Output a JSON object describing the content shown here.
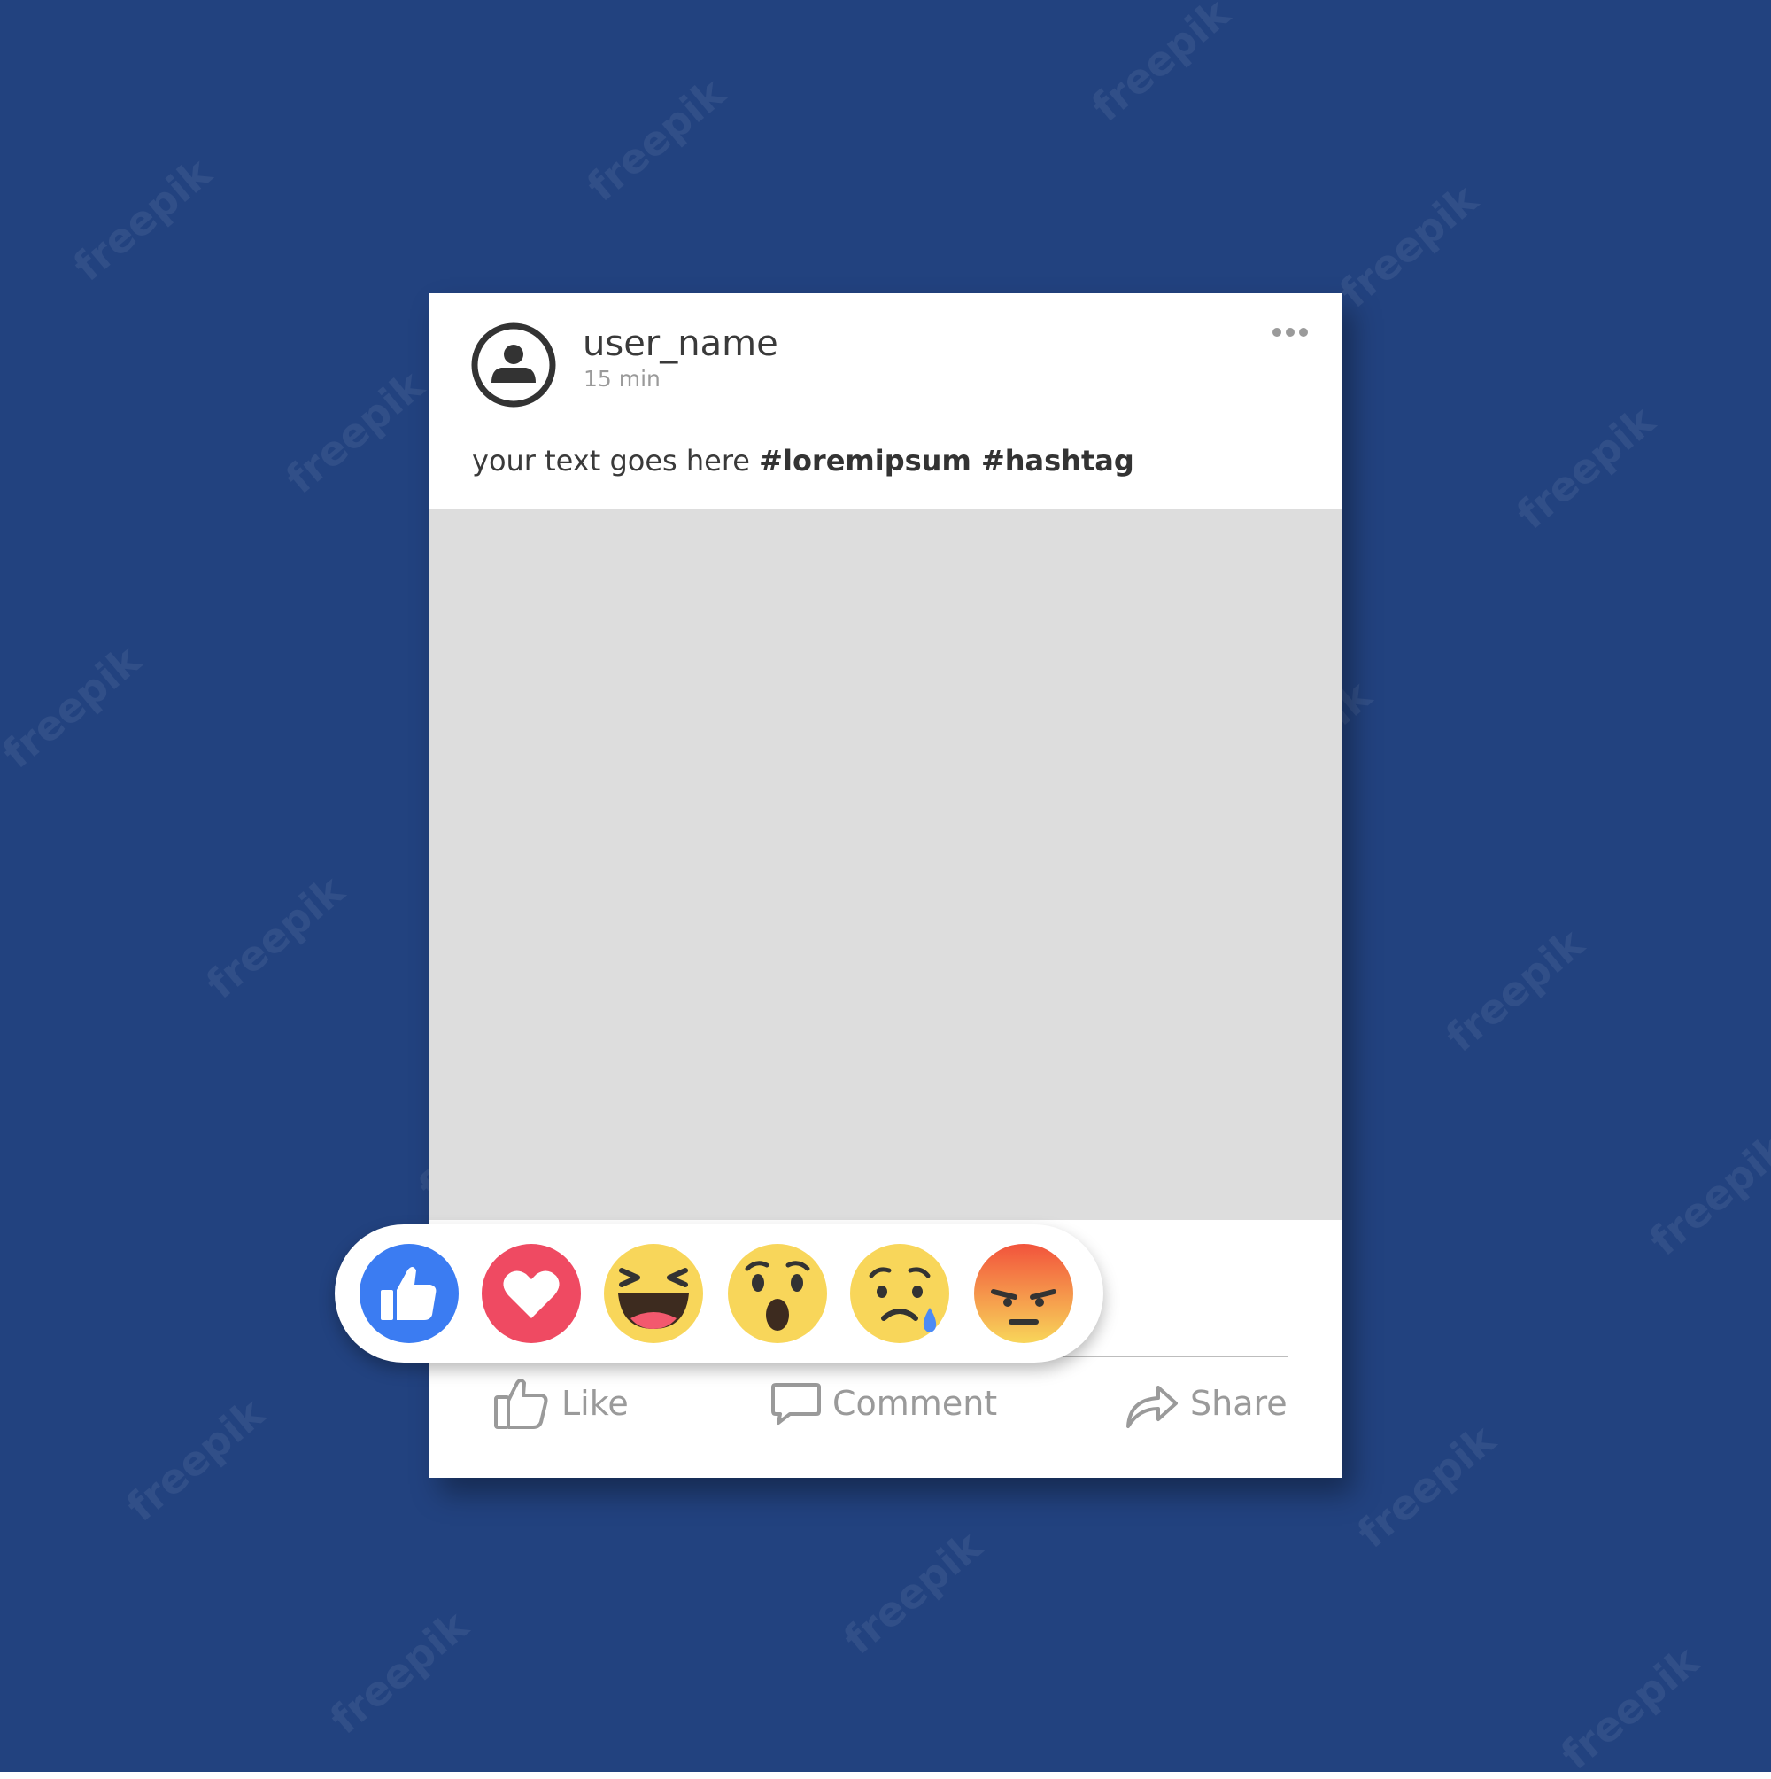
{
  "colors": {
    "background": "#22427f",
    "card": "#ffffff",
    "media_placeholder": "#dddddd",
    "text_dark": "#3a3a3a",
    "text_muted": "#9a9a9a",
    "like_blue": "#3b7cf2",
    "love_red": "#ef4a62",
    "emoji_yellow": "#f8d65a",
    "angry_orange": "#f26a36"
  },
  "post": {
    "username": "user_name",
    "timestamp": "15 min",
    "text_plain": "your text goes here ",
    "text_hashtags": "#loremipsum #hashtag",
    "more_icon": "ellipsis-icon",
    "avatar_icon": "user-avatar-icon"
  },
  "reactions": [
    {
      "name": "like",
      "icon": "thumbs-up-icon"
    },
    {
      "name": "love",
      "icon": "heart-icon"
    },
    {
      "name": "haha",
      "icon": "laughing-face-icon"
    },
    {
      "name": "wow",
      "icon": "surprised-face-icon"
    },
    {
      "name": "sad",
      "icon": "crying-face-icon"
    },
    {
      "name": "angry",
      "icon": "angry-face-icon"
    }
  ],
  "actions": {
    "like_label": "Like",
    "comment_label": "Comment",
    "share_label": "Share"
  },
  "watermark": {
    "text": "freepik"
  }
}
